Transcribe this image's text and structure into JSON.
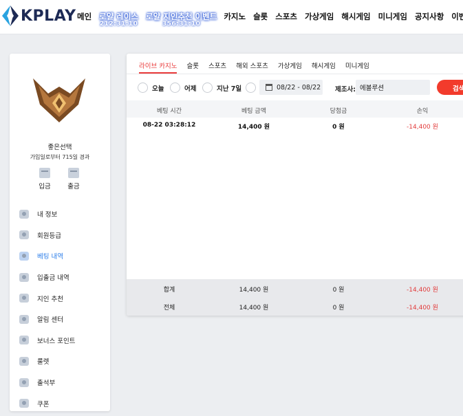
{
  "header": {
    "logo_text": "KPLAY",
    "nav": [
      {
        "label": "메인"
      },
      {
        "label": "로얄 레이스",
        "sub": "212:31:10",
        "glow": true
      },
      {
        "label": "로얄 지인추천 이벤트",
        "sub": "356:31:10",
        "glow": true
      },
      {
        "label": "카지노"
      },
      {
        "label": "슬롯"
      },
      {
        "label": "스포츠"
      },
      {
        "label": "가상게임"
      },
      {
        "label": "해시게임"
      },
      {
        "label": "미니게임"
      },
      {
        "label": "공지사항"
      },
      {
        "label": "이벤트"
      }
    ]
  },
  "sidebar": {
    "user_name": "좋은선택",
    "user_sub": "가입일로부터 715일 경과",
    "deposit_label": "입금",
    "withdraw_label": "출금",
    "menu": [
      {
        "label": "내 정보",
        "icon": "profile-icon"
      },
      {
        "label": "회원등급",
        "icon": "grade-icon"
      },
      {
        "label": "베팅 내역",
        "icon": "betting-history-icon",
        "active": true
      },
      {
        "label": "입출금 내역",
        "icon": "transaction-icon"
      },
      {
        "label": "지인 추천",
        "icon": "referral-icon"
      },
      {
        "label": "알림 센터",
        "icon": "notification-icon"
      },
      {
        "label": "보너스 포인트",
        "icon": "bonus-icon"
      },
      {
        "label": "룰렛",
        "icon": "roulette-icon"
      },
      {
        "label": "출석부",
        "icon": "attendance-icon"
      },
      {
        "label": "쿠폰",
        "icon": "coupon-icon"
      }
    ]
  },
  "main": {
    "tabs": [
      "라이브 카지노",
      "슬롯",
      "스포츠",
      "해외 스포츠",
      "가상게임",
      "해시게임",
      "미니게임"
    ],
    "active_tab": 0,
    "filters": {
      "today": "오늘",
      "yesterday": "어제",
      "last7": "지난 7일",
      "date_range": "08/22 - 08/22",
      "maker_label": "제조사:",
      "maker_value": "에볼루션",
      "search_label": "검색"
    },
    "columns": [
      "베팅 시간",
      "베팅 금액",
      "당첨금",
      "손익"
    ],
    "rows": [
      {
        "time": "08-22 03:28:12",
        "amount": "14,400 원",
        "win": "0 원",
        "pl": "-14,400 원"
      }
    ],
    "total": {
      "label": "합계",
      "amount": "14,400 원",
      "win": "0 원",
      "pl": "-14,400 원"
    },
    "all": {
      "label": "전체",
      "amount": "14,400 원",
      "win": "0 원",
      "pl": "-14,400 원"
    }
  },
  "colors": {
    "accent": "#e93a3a",
    "active_menu": "#2b7de9",
    "negative": "#e23b3b",
    "logo": "#1d2a55"
  }
}
